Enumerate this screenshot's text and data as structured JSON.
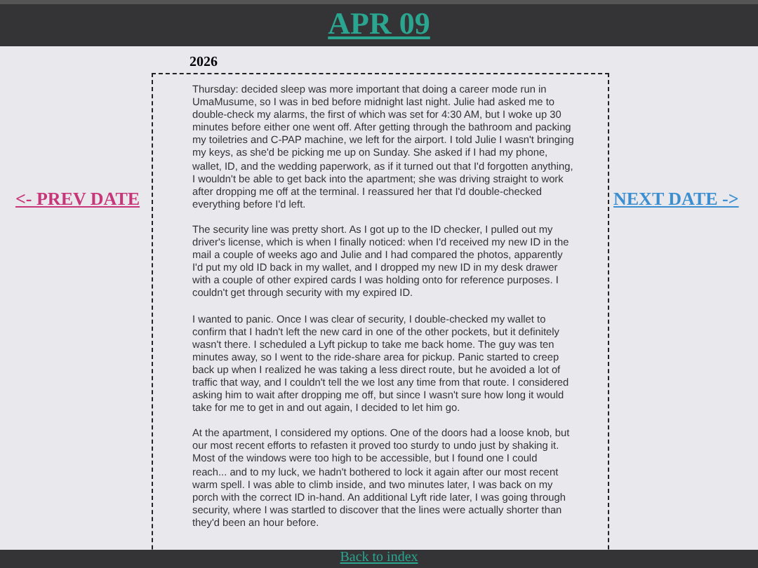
{
  "header": {
    "title": "APR 09"
  },
  "prev_link": "<- PREV DATE",
  "next_link": "NEXT DATE ->",
  "year": "2026",
  "paragraphs": [
    "Thursday: decided sleep was more important that doing a career mode run in UmaMusume, so I was in bed before midnight last night. Julie had asked me to double-check my alarms, the first of which was set for 4:30 AM, but I woke up 30 minutes before either one went off. After getting through the bathroom and packing my toiletries and C-PAP machine, we left for the airport. I told Julie I wasn't bringing my keys, as she'd be picking me up on Sunday. She asked if I had my phone, wallet, ID, and the wedding paperwork, as if it turned out that I'd forgotten anything, I wouldn't be able to get back into the apartment; she was driving straight to work after dropping me off at the terminal. I reassured her that I'd double-checked everything before I'd left.",
    "The security line was pretty short. As I got up to the ID checker, I pulled out my driver's license, which is when I finally noticed: when I'd received my new ID in the mail a couple of weeks ago and Julie and I had compared the photos, apparently I'd put my old ID back in my wallet, and I dropped my new ID in my desk drawer with a couple of other expired cards I was holding onto for reference purposes. I couldn't get through security with my expired ID.",
    "I wanted to panic. Once I was clear of security, I double-checked my wallet to confirm that I hadn't left the new card in one of the other pockets, but it definitely wasn't there. I scheduled a Lyft pickup to take me back home. The guy was ten minutes away, so I went to the ride-share area for pickup. Panic started to creep back up when I realized he was taking a less direct route, but he avoided a lot of traffic that way, and I couldn't tell the we lost any time from that route. I considered asking him to wait after dropping me off, but since I wasn't sure how long it would take for me to get in and out again, I decided to let him go.",
    "At the apartment, I considered my options. One of the doors had a loose knob, but our most recent efforts to refasten it proved too sturdy to undo just by shaking it. Most of the windows were too high to be accessible, but I found one I could reach... and to my luck, we hadn't bothered to lock it again after our most recent warm spell. I was able to climb inside, and two minutes later, I was back on my porch with the correct ID in-hand. An additional Lyft ride later, I was going through security, where I was startled to discover that the lines were actually shorter than they'd been an hour before."
  ],
  "footer": {
    "link": "Back to index"
  }
}
